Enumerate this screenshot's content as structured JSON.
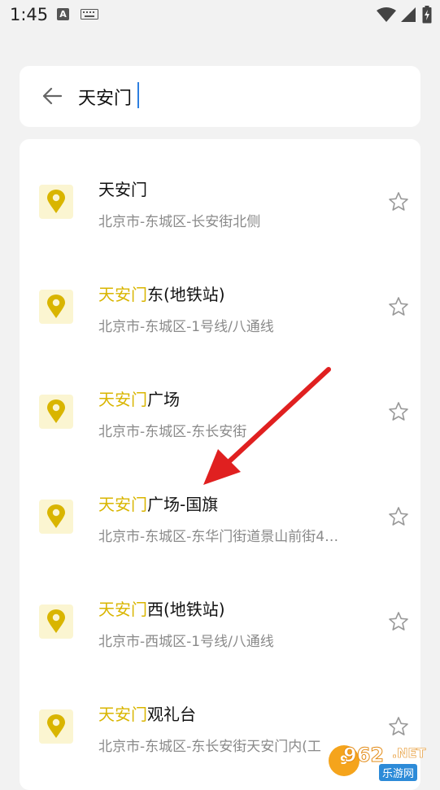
{
  "status_bar": {
    "time": "1:45",
    "notification_badge": "A"
  },
  "search": {
    "query": "天安门",
    "placeholder": ""
  },
  "results": [
    {
      "highlight": "",
      "title_rest": "天安门",
      "address": "北京市-东城区-长安街北侧"
    },
    {
      "highlight": "天安门",
      "title_rest": "东(地铁站)",
      "address": "北京市-东城区-1号线/八通线"
    },
    {
      "highlight": "天安门",
      "title_rest": "广场",
      "address": "北京市-东城区-东长安街"
    },
    {
      "highlight": "天安门",
      "title_rest": "广场-国旗",
      "address": "北京市-东城区-东华门街道景山前街4…"
    },
    {
      "highlight": "天安门",
      "title_rest": "西(地铁站)",
      "address": "北京市-西城区-1号线/八通线"
    },
    {
      "highlight": "天安门",
      "title_rest": "观礼台",
      "address": "北京市-东城区-东长安街天安门内(工"
    }
  ],
  "watermark": {
    "circle": "9",
    "big": "962",
    "small": "乐游网",
    "suffix": ".NET"
  },
  "colors": {
    "accent_yellow": "#d9b500",
    "pin_bg": "#fbf5d1",
    "arrow_red": "#e02020"
  },
  "icons": {
    "back": "arrow-left-icon",
    "pin": "map-pin-icon",
    "star": "star-outline-icon"
  }
}
